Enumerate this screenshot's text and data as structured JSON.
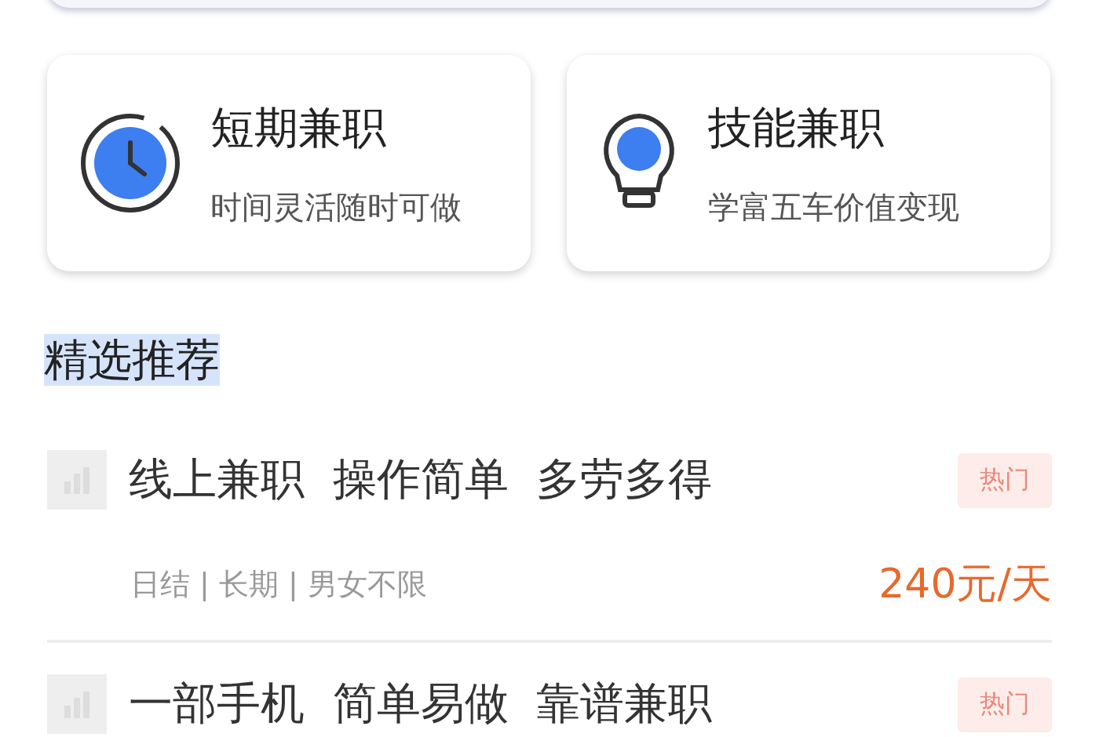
{
  "categories": [
    {
      "kind": "clock",
      "title": "短期兼职",
      "subtitle": "时间灵活随时可做"
    },
    {
      "kind": "bulb",
      "title": "技能兼职",
      "subtitle": "学富五车价值变现"
    }
  ],
  "section": {
    "title": "精选推荐"
  },
  "jobs": [
    {
      "title": "线上兼职  操作简单  多劳多得",
      "tag": "热门",
      "meta": "日结 | 长期 | 男女不限",
      "price": "240元/天"
    },
    {
      "title": "一部手机  简单易做  靠谱兼职",
      "tag": "热门"
    }
  ]
}
